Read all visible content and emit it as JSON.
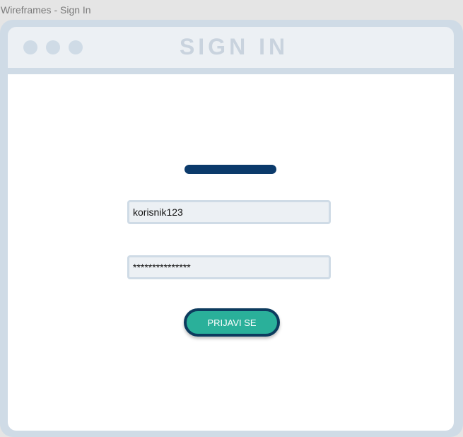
{
  "frame": {
    "label": "Wireframes - Sign In"
  },
  "window": {
    "title": "SIGN IN"
  },
  "form": {
    "username": {
      "value": "korisnik123"
    },
    "password": {
      "value": "***************"
    },
    "submit_label": "PRIJAVI SE"
  },
  "colors": {
    "window_frame": "#cfdbe6",
    "titlebar": "#ecf0f4",
    "logo_bar": "#0b3a6b",
    "button_fill": "#2ab09a",
    "button_border": "#0d3b5e"
  }
}
